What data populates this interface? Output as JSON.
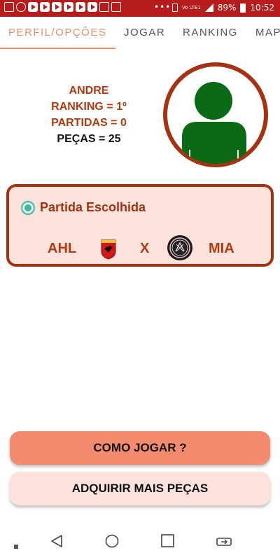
{
  "statusbar": {
    "dots": "•••",
    "network_label": "Vo LTE1",
    "battery": "89%",
    "time": "10:52",
    "icons": [
      "gallery-icon",
      "whatsapp-icon",
      "youtube-icon",
      "youtube-icon",
      "youtube-icon",
      "youtube-icon",
      "youtube-icon",
      "youtube-icon",
      "calendar-icon",
      "screen-icon"
    ]
  },
  "tabs": [
    {
      "label": "PERFIL/OPÇÕES",
      "active": true
    },
    {
      "label": "JOGAR",
      "active": false
    },
    {
      "label": "RANKING",
      "active": false
    },
    {
      "label": "MAP",
      "active": false
    }
  ],
  "profile": {
    "name": "ANDRE",
    "ranking": "RANKING = 1º",
    "partidas": "PARTIDAS = 0",
    "pecas": "PEÇAS = 25",
    "avatar_icon": "user-avatar-icon"
  },
  "match": {
    "title": "Partida Escolhida",
    "selected": true,
    "home": "AHL",
    "separator": "X",
    "away": "MIA",
    "home_crest": "al-ahly-crest-icon",
    "away_crest": "inter-miami-crest-icon"
  },
  "buttons": {
    "how_to_play": "COMO JOGAR ?",
    "buy_pieces": "ADQUIRIR MAIS PEÇAS"
  },
  "colors": {
    "status_bar": "#b71c1c",
    "accent": "#e8906e",
    "dark_red": "#a33312",
    "card_bg": "#fde3dc",
    "avatar_green": "#0b6b14",
    "radio": "#2fbfa6",
    "primary_button": "#f48a6e"
  },
  "navbar": {
    "items": [
      "square-dot-icon",
      "back-icon",
      "home-icon",
      "recents-icon",
      "switch-apps-icon"
    ]
  }
}
